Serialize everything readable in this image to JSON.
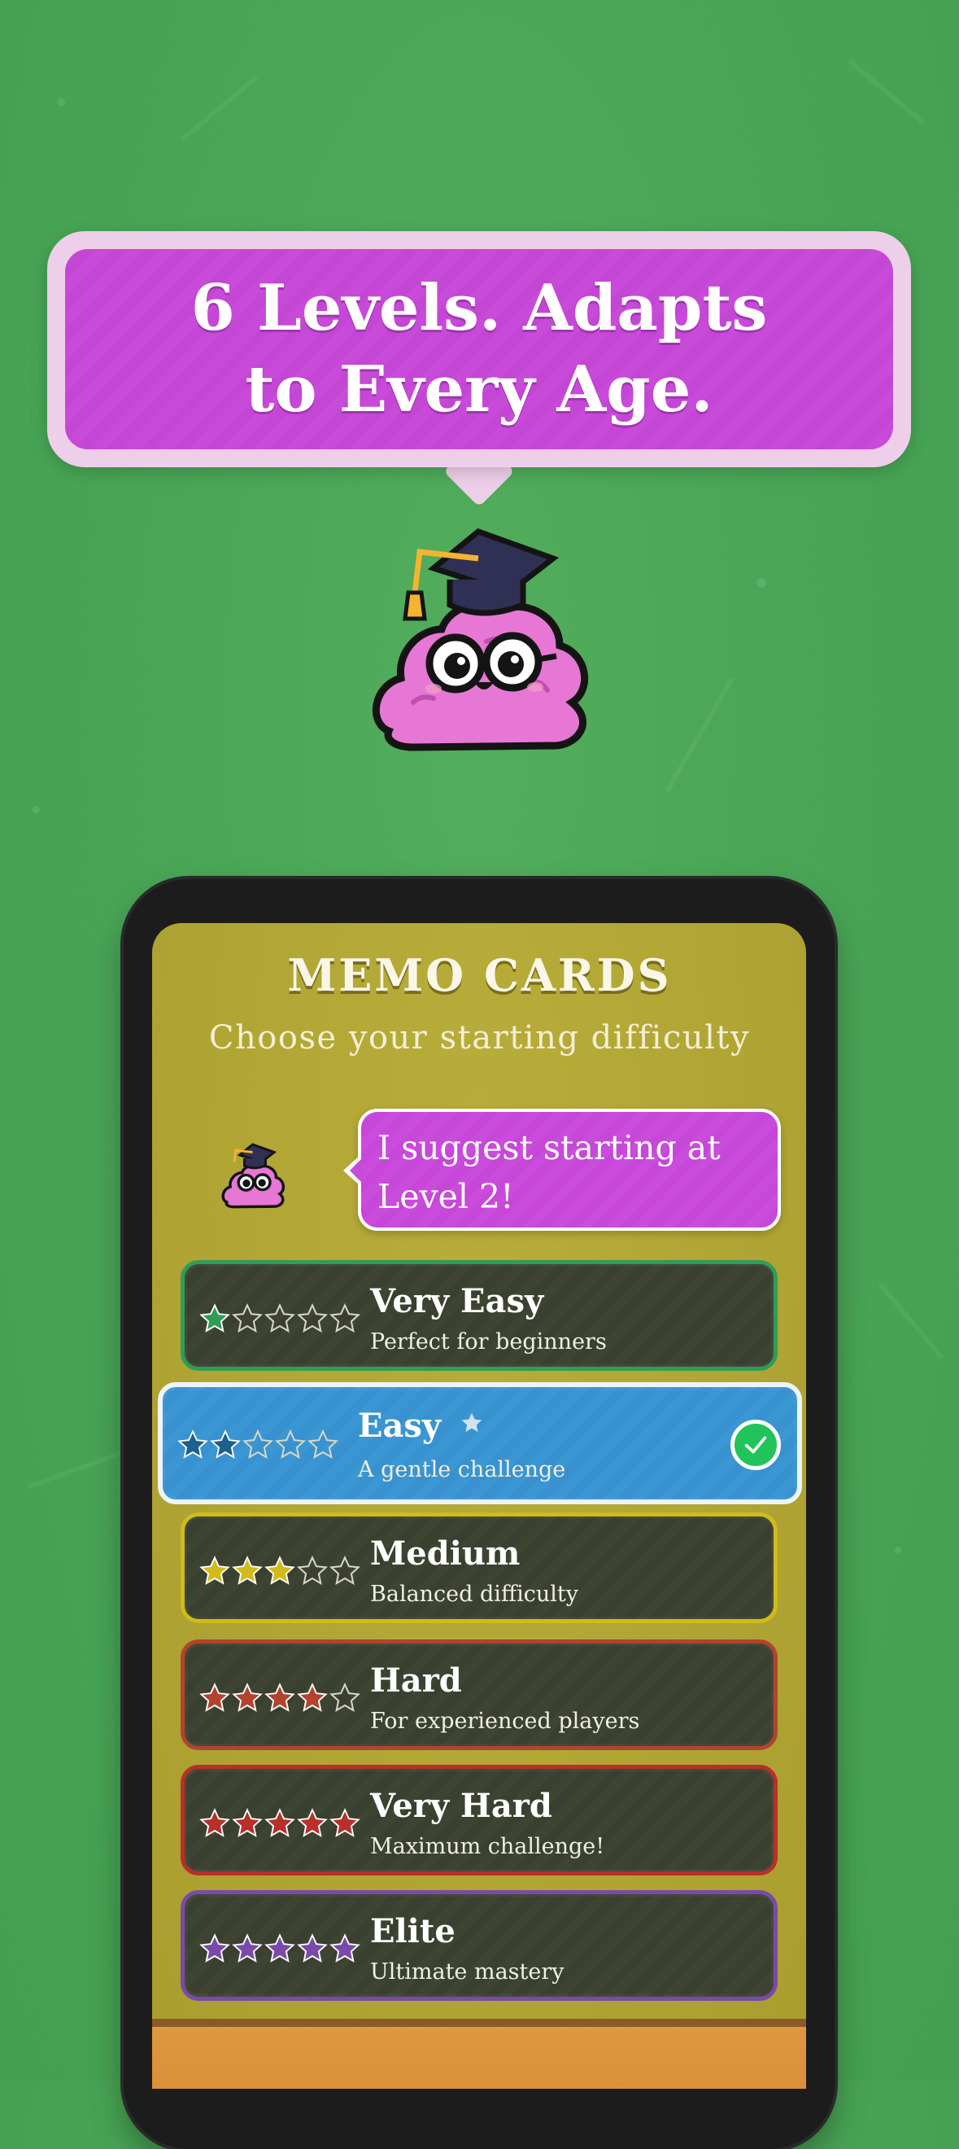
{
  "promo": {
    "headline": "6 Levels. Adapts to Every Age."
  },
  "app": {
    "title": "MEMO CARDS",
    "subtitle": "Choose your starting difficulty",
    "tip": "I suggest starting at Level 2!"
  },
  "levels": [
    {
      "name": "Very Easy",
      "desc": "Perfect for beginners",
      "stars": 1,
      "color": "#2e9d57",
      "selected": false
    },
    {
      "name": "Easy",
      "desc": "A gentle challenge",
      "stars": 2,
      "color": "#1d5f8e",
      "selected": true
    },
    {
      "name": "Medium",
      "desc": "Balanced difficulty",
      "stars": 3,
      "color": "#d1bb1a",
      "selected": false
    },
    {
      "name": "Hard",
      "desc": "For experienced players",
      "stars": 4,
      "color": "#b2442e",
      "selected": false
    },
    {
      "name": "Very Hard",
      "desc": "Maximum challenge!",
      "stars": 5,
      "color": "#b8302a",
      "selected": false
    },
    {
      "name": "Elite",
      "desc": "Ultimate mastery",
      "stars": 5,
      "color": "#7b4aa8",
      "selected": false
    }
  ],
  "colors": {
    "background": "#4aa657",
    "promo_purple": "#c84ad9",
    "screen_olive": "#b0a534",
    "selected_blue": "#3b97d3",
    "check_green": "#20c45a"
  },
  "icons": [
    "graduation-cap-icon",
    "star-icon",
    "check-icon"
  ]
}
